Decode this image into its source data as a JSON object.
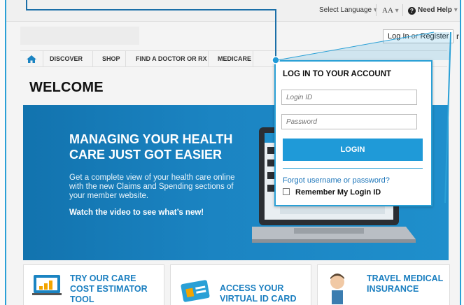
{
  "topbar": {
    "select_language": "Select Language",
    "text_size": "AA",
    "need_help": "Need Help"
  },
  "header": {
    "login": "Log In",
    "or": "or",
    "register": "Register",
    "trailing_char": "r"
  },
  "nav": {
    "items": [
      {
        "label": "DISCOVER"
      },
      {
        "label": "SHOP"
      },
      {
        "label": "FIND A DOCTOR OR RX"
      },
      {
        "label": "MEDICARE"
      }
    ]
  },
  "page": {
    "title": "WELCOME"
  },
  "hero": {
    "heading": "MANAGING YOUR HEALTH CARE JUST GOT EASIER",
    "body": "Get a complete view of your health care online with the new Claims and Spending sections of your member website.",
    "cta": "Watch the video to see what’s new!"
  },
  "cards": [
    {
      "title": "TRY OUR CARE COST ESTIMATOR TOOL"
    },
    {
      "title": "ACCESS YOUR VIRTUAL ID CARD"
    },
    {
      "title": "TRAVEL MEDICAL INSURANCE"
    }
  ],
  "login_panel": {
    "title": "LOG IN TO YOUR ACCOUNT",
    "login_id_placeholder": "Login ID",
    "password_placeholder": "Password",
    "submit": "LOGIN",
    "forgot": "Forgot username or password?",
    "remember": "Remember My Login ID"
  },
  "colors": {
    "accent": "#2aa0d6",
    "hero_blue": "#1b84c2",
    "button_blue": "#1f9ad8",
    "link_blue": "#1a74b9"
  }
}
